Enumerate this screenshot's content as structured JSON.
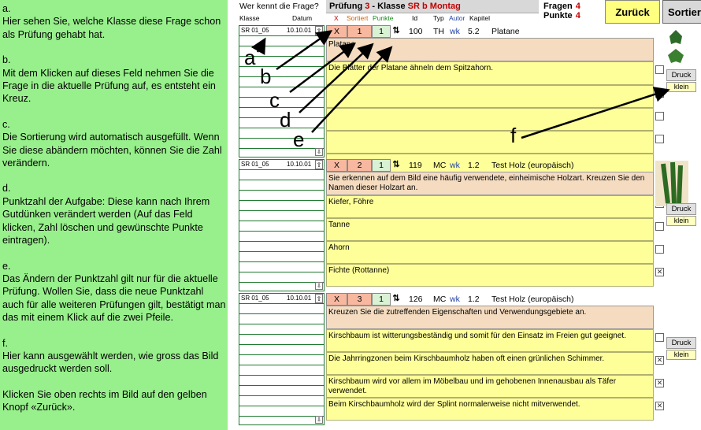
{
  "help": {
    "paragraphs": [
      "a.\nHier sehen Sie, welche Klasse diese Frage schon als Prüfung gehabt hat.",
      "b.\nMit dem Klicken auf dieses Feld nehmen Sie die Frage in die aktuelle Prüfung auf, es entsteht ein Kreuz.",
      "c.\nDie Sortierung wird automatisch ausgefüllt. Wenn Sie diese abändern möchten, können Sie die Zahl verändern.",
      "d.\nPunktzahl der Aufgabe: Diese kann nach Ihrem Gutdünken verändert werden (Auf das Feld klicken, Zahl löschen und gewünschte Punkte eintragen).",
      "e.\nDas Ändern der Punktzahl gilt nur für die aktuelle Prüfung. Wollen Sie, dass die neue Punktzahl auch für alle weiteren Prüfungen gilt, bestätigt man das mit einem Klick auf die zwei Pfeile.",
      "f.\nHier kann ausgewählt werden, wie gross das Bild ausgedruckt werden soll.",
      "Klicken Sie oben rechts im Bild auf den gelben Knopf «Zurück»."
    ]
  },
  "history_header": {
    "title": "Wer kennt die Frage?",
    "klasse": "Klasse",
    "datum": "Datum"
  },
  "pruefung": {
    "label": "Prüfung",
    "num": "3",
    "sep": " -  Klasse ",
    "klasse": "SR b Montag"
  },
  "columns": {
    "x": "X",
    "sortiert": "Sortiert",
    "punkte": "Punkte",
    "id": "Id",
    "typ": "Typ",
    "autor": "Autor",
    "kapitel": "Kapitel"
  },
  "counts": {
    "fragen_label": "Fragen",
    "fragen": "4",
    "punkte_label": "Punkte",
    "punkte": "4"
  },
  "buttons": {
    "back": "Zurück",
    "sort": "Sortier"
  },
  "questions": [
    {
      "hist_klasse": "SR 01_05",
      "hist_datum": "10.10.01",
      "x": "X",
      "sort": "1",
      "points": "1",
      "id": "100",
      "typ": "TH",
      "autor": "wk",
      "kapitel": "5.2",
      "topic": "Platane",
      "text": "Platane",
      "answers": [
        "Die Blätter der Platane ähneln dem Spitzahorn.",
        "",
        "",
        "",
        ""
      ],
      "checked": [
        false,
        false,
        false,
        false
      ],
      "druck": "Druck",
      "size": "klein"
    },
    {
      "hist_klasse": "SR 01_05",
      "hist_datum": "10.10.01",
      "x": "X",
      "sort": "2",
      "points": "1",
      "id": "119",
      "typ": "MC",
      "autor": "wk",
      "kapitel": "1.2",
      "topic": "Test  Holz (europäisch)",
      "text": "Sie erkennen auf dem Bild eine häufig verwendete, einheimische Holzart. Kreuzen Sie den Namen dieser Holzart an.",
      "answers": [
        "Kiefer, Föhre",
        "Tanne",
        "Ahorn",
        "Fichte (Rottanne)"
      ],
      "checked": [
        false,
        false,
        false,
        true
      ],
      "druck": "Druck",
      "size": "klein"
    },
    {
      "hist_klasse": "SR 01_05",
      "hist_datum": "10.10.01",
      "x": "X",
      "sort": "3",
      "points": "1",
      "id": "126",
      "typ": "MC",
      "autor": "wk",
      "kapitel": "1.2",
      "topic": "Test  Holz (europäisch)",
      "text": "Kreuzen Sie die zutreffenden Eigenschaften und Verwendungsgebiete an.",
      "answers": [
        "Kirschbaum ist witterungsbeständig und somit für den Einsatz im Freien gut geeignet.",
        "Die Jahrringzonen beim Kirschbaumholz haben oft einen grünlichen Schimmer.",
        "Kirschbaum wird vor allem im Möbelbau und im gehobenen Innenausbau als Täfer verwendet.",
        "Beim Kirschbaumholz wird der Splint normalerweise nicht mitverwendet."
      ],
      "checked": [
        false,
        true,
        true,
        true
      ],
      "druck": "Druck",
      "size": "klein"
    }
  ],
  "callouts": [
    "a",
    "b",
    "c",
    "d",
    "e",
    "f"
  ],
  "colors": {
    "help_bg": "#98f08c",
    "accent_red": "#c00000",
    "answer_bg": "#ffff99",
    "question_bg": "#f5dcc0",
    "back_button": "#ffff80"
  }
}
